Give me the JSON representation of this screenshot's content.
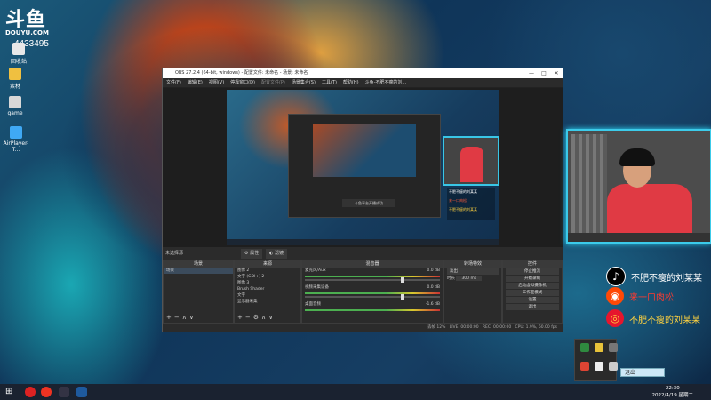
{
  "desktop": {
    "logo_main": "斗鱼",
    "logo_sub": "DOUYU.COM",
    "room_number": "4433495",
    "icons": [
      {
        "label": "回收站",
        "color": "#e8e8e8"
      },
      {
        "label": "素材",
        "color": "#f0c040"
      },
      {
        "label": "game",
        "color": "#d8d8d8"
      },
      {
        "label": "AirPlayer-T...",
        "color": "#3fa9f5"
      }
    ]
  },
  "obs": {
    "title": "OBS 27.2.4 (64-bit, windows) - 配置文件: 未命名 - 场景: 未命名",
    "menu": [
      "文件(F)",
      "编辑(E)",
      "视图(V)",
      "停靠窗口(D)",
      "配置文件(P)",
      "场景集合(S)",
      "工具(T)",
      "帮助(H)",
      "斗鱼-不肥不瘦的刘..."
    ],
    "window_controls": [
      "—",
      "□",
      "✕"
    ],
    "no_source_label": "未选择源",
    "properties_label": "属性",
    "filters_label": "滤镜",
    "panels": {
      "scenes": {
        "title": "场景",
        "items": [
          "场景"
        ]
      },
      "sources": {
        "title": "来源",
        "items": [
          "图像 2",
          "文字 (GDI+) 2",
          "图像 3",
          "Brush Shader",
          "文字",
          "显示器采集"
        ]
      },
      "mixer": {
        "title": "混音器",
        "channels": [
          {
            "name": "麦克风/Aux",
            "db": "0.0 dB"
          },
          {
            "name": "视频采集设备",
            "db": "0.0 dB"
          },
          {
            "name": "桌面音频",
            "db": "-1.6 dB"
          }
        ]
      },
      "transitions": {
        "title": "转场特效",
        "type": "淡出",
        "duration_label": "时长",
        "duration": "300 ms"
      },
      "controls": {
        "title": "控件",
        "buttons": [
          "停止推流",
          "开始录制",
          "启动虚拟摄像机",
          "工作室模式",
          "设置",
          "退出"
        ]
      }
    },
    "status": {
      "dropped": "丢帧 12%",
      "live": "LIVE: 00:00:00",
      "rec": "REC: 00:00:00",
      "cpu": "CPU: 1.9%, 60.00 fps"
    }
  },
  "preview_text": {
    "inner_caption": "斗鱼平台开播成功",
    "social_small": [
      "不肥不瘦的刘某某",
      "来一口肉松",
      "不肥不瘦的刘某某"
    ]
  },
  "social": [
    {
      "name": "不肥不瘦的刘某某",
      "icon": "tiktok-icon",
      "color": "#000000",
      "text_color": "#ffffff"
    },
    {
      "name": "来一口肉松",
      "icon": "kuaishou-icon",
      "color": "#ff4906",
      "text_color": "#ff3a30"
    },
    {
      "name": "不肥不瘦的刘某某",
      "icon": "weibo-icon",
      "color": "#e6162d",
      "text_color": "#ffd23f"
    }
  ],
  "tray_menu": {
    "exit_label": "退出"
  },
  "taskbar": {
    "time": "22:30",
    "date": "2022/4/19 星期二"
  }
}
